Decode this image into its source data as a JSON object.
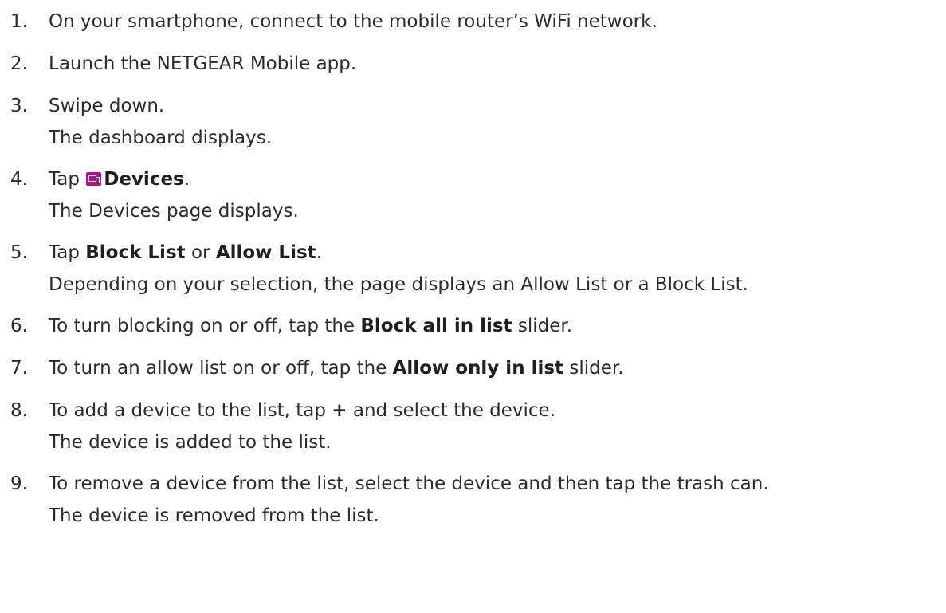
{
  "steps": [
    {
      "num": "1.",
      "text": "On your smartphone, connect to the mobile router’s WiFi network."
    },
    {
      "num": "2.",
      "text": "Launch the NETGEAR Mobile app."
    },
    {
      "num": "3.",
      "text": "Swipe down.",
      "result": "The dashboard displays."
    },
    {
      "num": "4.",
      "before": "Tap ",
      "bold": "Devices",
      "after": ".",
      "icon": "devices-icon",
      "result": "The Devices page displays."
    },
    {
      "num": "5.",
      "before": "Tap ",
      "bold1": "Block List",
      "middle": " or ",
      "bold2": "Allow List",
      "after": ".",
      "result": "Depending on your selection, the page displays an Allow List or a Block List."
    },
    {
      "num": "6.",
      "before": "To turn blocking on or off, tap the ",
      "bold": "Block all in list",
      "after": " slider."
    },
    {
      "num": "7.",
      "before": "To turn an allow list on or off, tap the ",
      "bold": "Allow only in list",
      "after": " slider."
    },
    {
      "num": "8.",
      "before": "To add a device to the list, tap ",
      "bold": "+",
      "after": " and select the device.",
      "result": "The device is added to the list."
    },
    {
      "num": "9.",
      "text": "To remove a device from the list, select the device and then tap the trash can.",
      "result": "The device is removed from the list."
    }
  ],
  "colors": {
    "text": "#2b2b2b",
    "icon_accent": "#b0128f"
  }
}
